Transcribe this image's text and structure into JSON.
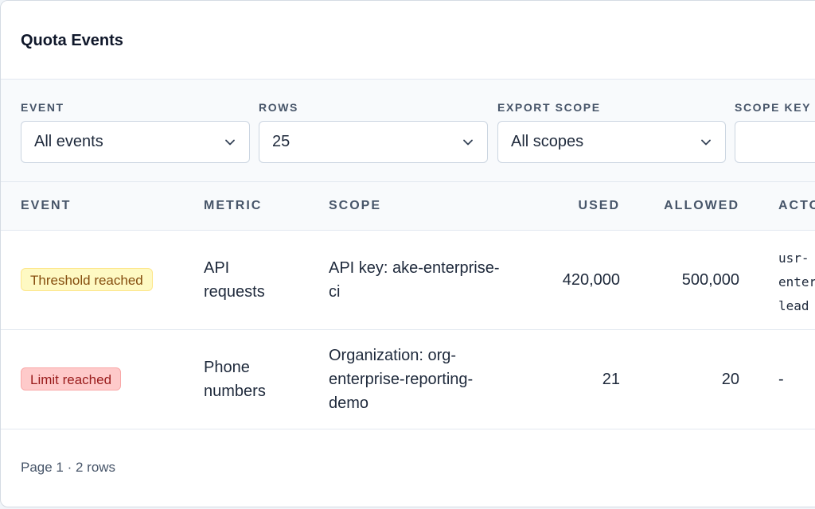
{
  "panel": {
    "title": "Quota Events"
  },
  "filters": [
    {
      "label": "EVENT",
      "value": "All events"
    },
    {
      "label": "ROWS",
      "value": "25"
    },
    {
      "label": "EXPORT SCOPE",
      "value": "All scopes"
    },
    {
      "label": "SCOPE KEY",
      "value": ""
    }
  ],
  "table": {
    "columns": [
      "EVENT",
      "METRIC",
      "SCOPE",
      "USED",
      "ALLOWED",
      "ACTOR"
    ],
    "rows": [
      {
        "event": "Threshold reached",
        "event_status": "warning",
        "metric": [
          "API",
          "requests"
        ],
        "scope": [
          "API key: ake-enterprise-",
          "ci"
        ],
        "used": "420,000",
        "allowed": "500,000",
        "actor": [
          "usr-",
          "enterprise-",
          "lead"
        ]
      },
      {
        "event": "Limit reached",
        "event_status": "danger",
        "metric": [
          "Phone",
          "numbers"
        ],
        "scope": [
          "Organization: org-",
          "enterprise-reporting-",
          "demo"
        ],
        "used": "21",
        "allowed": "20",
        "actor": [
          "-"
        ]
      }
    ]
  },
  "footer": {
    "pagination": "Page 1 · 2 rows"
  },
  "colors": {
    "warning_bg": "#fef9c3",
    "warning_text": "#854d0e",
    "danger_bg": "#fecaca",
    "danger_text": "#991b1b"
  },
  "icons": {
    "select_chevron": "chevron-down-icon"
  }
}
